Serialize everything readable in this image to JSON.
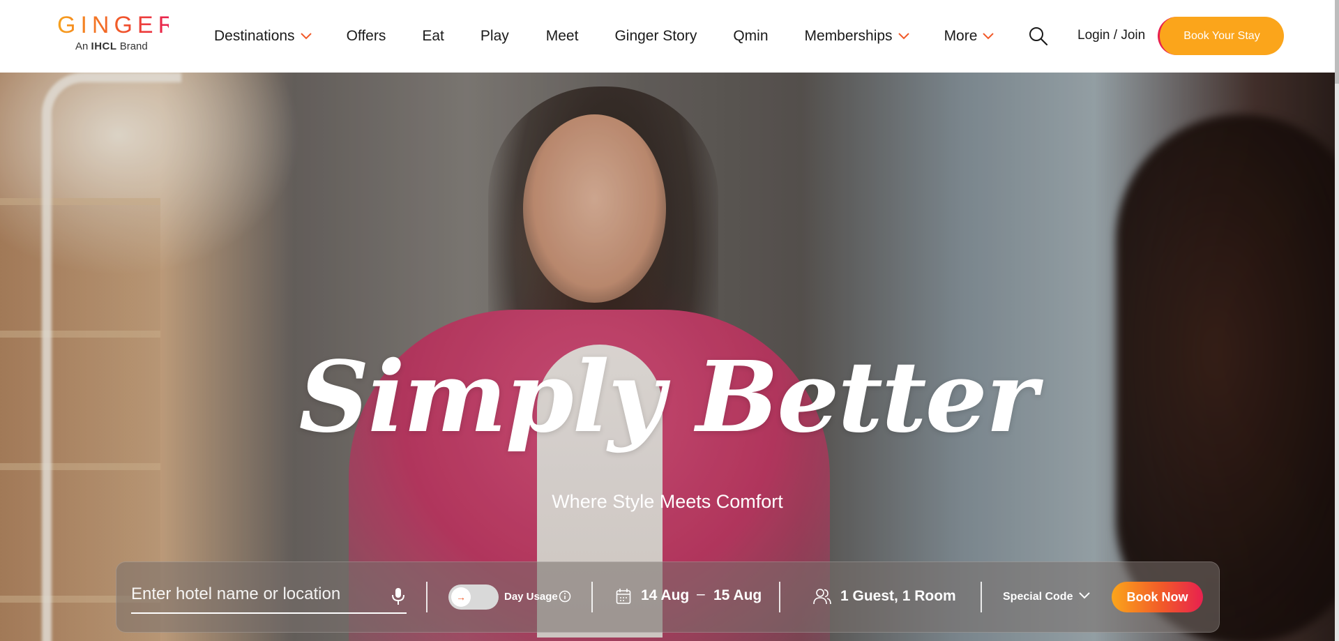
{
  "brand": {
    "name": "GINGER",
    "tagline_prefix": "An",
    "tagline_brand": "IHCL",
    "tagline_suffix": "Brand",
    "accent_colors": [
      "#fba51b",
      "#f15a29",
      "#e8214f"
    ]
  },
  "nav": {
    "items": [
      {
        "label": "Destinations",
        "dropdown": true
      },
      {
        "label": "Offers",
        "dropdown": false
      },
      {
        "label": "Eat",
        "dropdown": false
      },
      {
        "label": "Play",
        "dropdown": false
      },
      {
        "label": "Meet",
        "dropdown": false
      },
      {
        "label": "Ginger Story",
        "dropdown": false
      },
      {
        "label": "Qmin",
        "dropdown": false
      },
      {
        "label": "Memberships",
        "dropdown": true
      },
      {
        "label": "More",
        "dropdown": true
      }
    ],
    "search_icon": "search-icon",
    "login_label": "Login / Join",
    "book_stay_label": "Book Your Stay"
  },
  "hero": {
    "title": "Simply Better",
    "subtitle": "Where Style Meets Comfort"
  },
  "booking": {
    "search_placeholder": "Enter hotel name or location",
    "search_value": "",
    "day_usage_label": "Day Usage",
    "day_usage_enabled": false,
    "check_in": "14 Aug",
    "date_separator": "–",
    "check_out": "15 Aug",
    "guests_rooms": "1 Guest, 1 Room",
    "special_code_label": "Special Code",
    "book_now_label": "Book Now"
  }
}
